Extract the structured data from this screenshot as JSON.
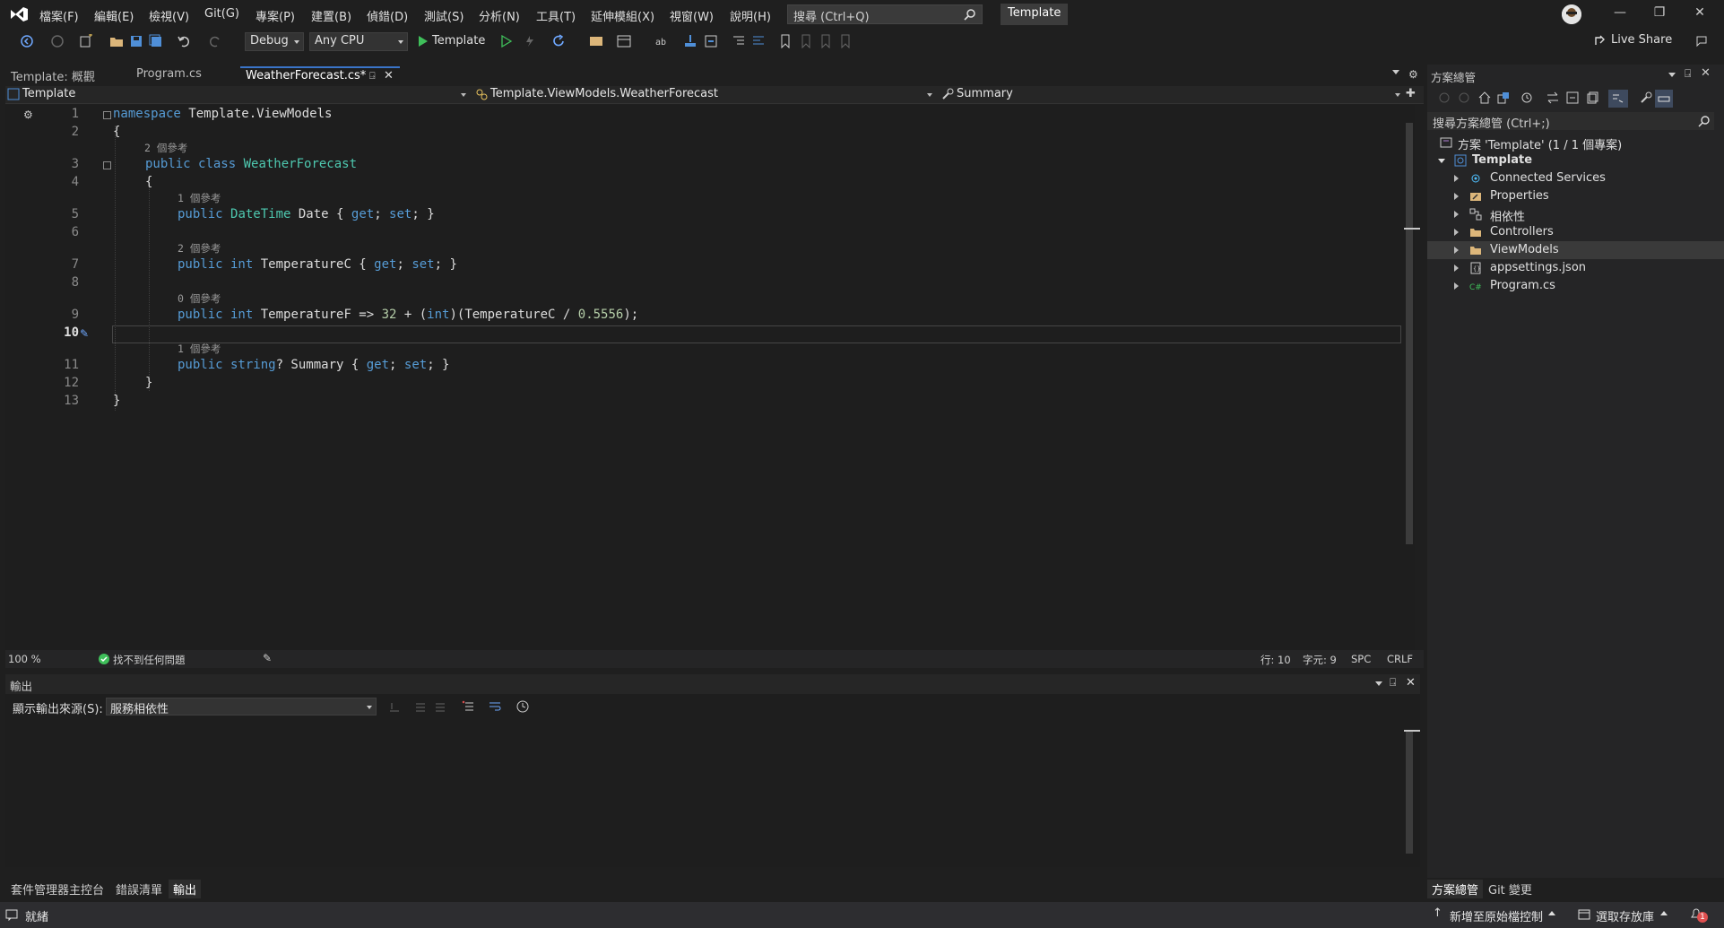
{
  "menubar": {
    "items": [
      "檔案(F)",
      "編輯(E)",
      "檢視(V)",
      "Git(G)",
      "專案(P)",
      "建置(B)",
      "偵錯(D)",
      "測試(S)",
      "分析(N)",
      "工具(T)",
      "延伸模組(X)",
      "視窗(W)",
      "說明(H)"
    ],
    "search_placeholder": "搜尋 (Ctrl+Q)",
    "solution_name": "Template"
  },
  "toolbar": {
    "configuration": "Debug",
    "platform": "Any CPU",
    "run_label": "Template",
    "live_share": "Live Share"
  },
  "doc_tabs": [
    {
      "label": "Template: 概觀"
    },
    {
      "label": "Program.cs"
    },
    {
      "label": "WeatherForecast.cs*"
    }
  ],
  "navbar": {
    "project": "Template",
    "type": "Template.ViewModels.WeatherForecast",
    "member": "Summary"
  },
  "editor": {
    "line_numbers": [
      "1",
      "2",
      "3",
      "4",
      "5",
      "6",
      "7",
      "8",
      "9",
      "10",
      "11",
      "12",
      "13"
    ],
    "lenses": {
      "class_refs": "2 個參考",
      "date_refs": "1 個參考",
      "tempc_refs": "2 個參考",
      "tempf_refs": "0 個參考",
      "summary_refs": "1 個參考"
    },
    "lines": {
      "l1_kw": "namespace",
      "l1_rest": " Template.ViewModels",
      "l2": "{",
      "l3_kw": "public class",
      "l3_type": "WeatherForecast",
      "l4": "{",
      "l5_kw": "public",
      "l5_type": "DateTime",
      "l5_name": " Date { ",
      "l5_get": "get",
      "l5_sep": "; ",
      "l5_set": "set",
      "l5_end": "; }",
      "l7_kw": "public int",
      "l7_name": " TemperatureC { ",
      "l7_get": "get",
      "l7_sep": "; ",
      "l7_set": "set",
      "l7_end": "; }",
      "l9_kw": "public int",
      "l9_a": " TemperatureF => ",
      "l9_num1": "32",
      "l9_b": " + (",
      "l9_int": "int",
      "l9_c": ")(TemperatureC / ",
      "l9_num2": "0.5556",
      "l9_d": ");",
      "l11_kw": "public string",
      "l11_name": "? Summary { ",
      "l11_get": "get",
      "l11_sep": "; ",
      "l11_set": "set",
      "l11_end": "; }",
      "l12": "}",
      "l13": "}"
    }
  },
  "editor_status": {
    "zoom": "100 %",
    "issues": "找不到任何問題",
    "line": "行: 10",
    "col": "字元: 9",
    "spc": "SPC",
    "eol": "CRLF"
  },
  "output": {
    "title": "輸出",
    "source_label": "顯示輸出來源(S):",
    "source_value": "服務相依性"
  },
  "bottom_tabs": [
    "套件管理器主控台",
    "錯誤清單",
    "輸出"
  ],
  "solution_explorer": {
    "title": "方案總管",
    "search_placeholder": "搜尋方案總管 (Ctrl+;)",
    "solution_row": "方案 'Template' (1 / 1 個專案)",
    "project": "Template",
    "items": [
      "Connected Services",
      "Properties",
      "相依性",
      "Controllers",
      "ViewModels",
      "appsettings.json",
      "Program.cs"
    ],
    "bottom_tabs": [
      "方案總管",
      "Git 變更"
    ]
  },
  "statusbar": {
    "ready": "就緒",
    "add_to_source_control": "新增至原始檔控制",
    "select_repository": "選取存放庫",
    "notification_count": "1"
  },
  "colors": {
    "keyword": "#569cd6",
    "type": "#4ec9b0",
    "number": "#b5cea8",
    "active_tab_accent": "#3a74c8"
  }
}
